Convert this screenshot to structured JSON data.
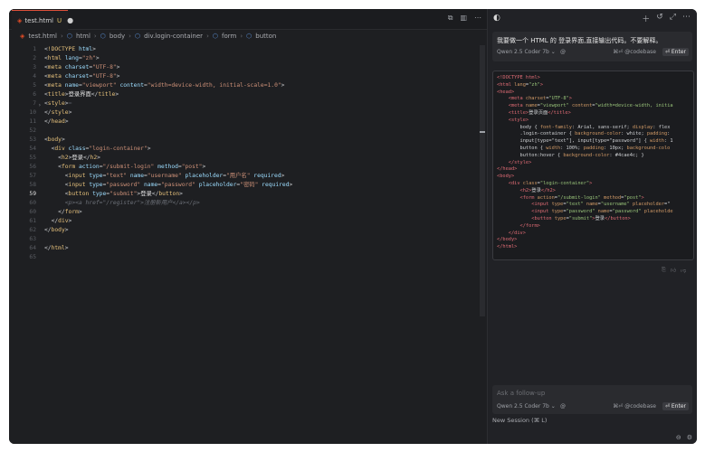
{
  "editor": {
    "tab": {
      "filename": "test.html",
      "badge": "U",
      "dot": "●"
    },
    "toolbar_icons": [
      "compare-icon",
      "split-icon",
      "more-icon"
    ],
    "breadcrumb": [
      "test.html",
      "html",
      "body",
      "div.login-container",
      "form",
      "button"
    ],
    "lines": [
      {
        "n": "1",
        "segs": [
          [
            "br",
            "<"
          ],
          [
            "tag",
            "!DOCTYPE"
          ],
          [
            "br",
            " "
          ],
          [
            "attr",
            "html"
          ],
          [
            "br",
            ">"
          ]
        ]
      },
      {
        "n": "2",
        "segs": [
          [
            "br",
            "<"
          ],
          [
            "tag",
            "html"
          ],
          [
            "br",
            " "
          ],
          [
            "attr",
            "lang"
          ],
          [
            "br",
            "="
          ],
          [
            "str",
            "\"zh\""
          ],
          [
            "br",
            ">"
          ]
        ]
      },
      {
        "n": "3",
        "segs": [
          [
            "br",
            "<"
          ],
          [
            "tag",
            "meta"
          ],
          [
            "br",
            " "
          ],
          [
            "attr",
            "charset"
          ],
          [
            "br",
            "="
          ],
          [
            "str",
            "\"UTF-8\""
          ],
          [
            "br",
            ">"
          ]
        ]
      },
      {
        "n": "4",
        "segs": [
          [
            "br",
            "<"
          ],
          [
            "tag",
            "meta"
          ],
          [
            "br",
            " "
          ],
          [
            "attr",
            "charset"
          ],
          [
            "br",
            "="
          ],
          [
            "str",
            "\"UTF-8\""
          ],
          [
            "br",
            ">"
          ]
        ]
      },
      {
        "n": "5",
        "segs": [
          [
            "br",
            "<"
          ],
          [
            "tag",
            "meta"
          ],
          [
            "br",
            " "
          ],
          [
            "attr",
            "name"
          ],
          [
            "br",
            "="
          ],
          [
            "str",
            "\"viewport\""
          ],
          [
            "br",
            " "
          ],
          [
            "attr",
            "content"
          ],
          [
            "br",
            "="
          ],
          [
            "str",
            "\"width=device-width, initial-scale=1.0\""
          ],
          [
            "br",
            ">"
          ]
        ]
      },
      {
        "n": "6",
        "segs": [
          [
            "br",
            "<"
          ],
          [
            "tag",
            "title"
          ],
          [
            "br",
            ">"
          ],
          [
            "text",
            "登录界面"
          ],
          [
            "br",
            "</"
          ],
          [
            "tag",
            "title"
          ],
          [
            "br",
            ">"
          ]
        ]
      },
      {
        "n": "7",
        "segs": [
          [
            "br",
            "<"
          ],
          [
            "tag",
            "style"
          ],
          [
            "br",
            ">"
          ],
          [
            "com",
            "⋯"
          ]
        ]
      },
      {
        "n": "10",
        "segs": [
          [
            "br",
            "</"
          ],
          [
            "tag",
            "style"
          ],
          [
            "br",
            ">"
          ]
        ]
      },
      {
        "n": "11",
        "segs": [
          [
            "br",
            "</"
          ],
          [
            "tag",
            "head"
          ],
          [
            "br",
            ">"
          ]
        ]
      },
      {
        "n": "52",
        "segs": []
      },
      {
        "n": "53",
        "segs": [
          [
            "br",
            "<"
          ],
          [
            "tag",
            "body"
          ],
          [
            "br",
            ">"
          ]
        ]
      },
      {
        "n": "54",
        "segs": [
          [
            "br",
            "  <"
          ],
          [
            "tag",
            "div"
          ],
          [
            "br",
            " "
          ],
          [
            "attr",
            "class"
          ],
          [
            "br",
            "="
          ],
          [
            "str",
            "\"login-container\""
          ],
          [
            "br",
            ">"
          ]
        ]
      },
      {
        "n": "55",
        "segs": [
          [
            "br",
            "    <"
          ],
          [
            "tag",
            "h2"
          ],
          [
            "br",
            ">"
          ],
          [
            "text",
            "登录"
          ],
          [
            "br",
            "</"
          ],
          [
            "tag",
            "h2"
          ],
          [
            "br",
            ">"
          ]
        ]
      },
      {
        "n": "56",
        "segs": [
          [
            "br",
            "    <"
          ],
          [
            "tag",
            "form"
          ],
          [
            "br",
            " "
          ],
          [
            "attr",
            "action"
          ],
          [
            "br",
            "="
          ],
          [
            "str",
            "\"/submit-login\""
          ],
          [
            "br",
            " "
          ],
          [
            "attr",
            "method"
          ],
          [
            "br",
            "="
          ],
          [
            "str",
            "\"post\""
          ],
          [
            "br",
            ">"
          ]
        ]
      },
      {
        "n": "57",
        "segs": [
          [
            "br",
            "      <"
          ],
          [
            "tag",
            "input"
          ],
          [
            "br",
            " "
          ],
          [
            "attr",
            "type"
          ],
          [
            "br",
            "="
          ],
          [
            "str",
            "\"text\""
          ],
          [
            "br",
            " "
          ],
          [
            "attr",
            "name"
          ],
          [
            "br",
            "="
          ],
          [
            "str",
            "\"username\""
          ],
          [
            "br",
            " "
          ],
          [
            "attr",
            "placeholder"
          ],
          [
            "br",
            "="
          ],
          [
            "str",
            "\"用户名\""
          ],
          [
            "br",
            " "
          ],
          [
            "attr",
            "required"
          ],
          [
            "br",
            ">"
          ]
        ]
      },
      {
        "n": "58",
        "segs": [
          [
            "br",
            "      <"
          ],
          [
            "tag",
            "input"
          ],
          [
            "br",
            " "
          ],
          [
            "attr",
            "type"
          ],
          [
            "br",
            "="
          ],
          [
            "str",
            "\"password\""
          ],
          [
            "br",
            " "
          ],
          [
            "attr",
            "name"
          ],
          [
            "br",
            "="
          ],
          [
            "str",
            "\"password\""
          ],
          [
            "br",
            " "
          ],
          [
            "attr",
            "placeholder"
          ],
          [
            "br",
            "="
          ],
          [
            "str",
            "\"密码\""
          ],
          [
            "br",
            " "
          ],
          [
            "attr",
            "required"
          ],
          [
            "br",
            ">"
          ]
        ]
      },
      {
        "n": "59",
        "cur": true,
        "segs": [
          [
            "br",
            "      <"
          ],
          [
            "tag",
            "button"
          ],
          [
            "br",
            " "
          ],
          [
            "attr",
            "type"
          ],
          [
            "br",
            "="
          ],
          [
            "str",
            "\"submit\""
          ],
          [
            "br",
            ">"
          ],
          [
            "text",
            "登录"
          ],
          [
            "br",
            "</"
          ],
          [
            "tag",
            "button"
          ],
          [
            "br",
            ">"
          ]
        ]
      },
      {
        "n": "60",
        "segs": [
          [
            "com",
            "      <p>"
          ],
          [
            "com",
            "<a href=\"/register\">"
          ],
          [
            "com",
            "注册新用户"
          ],
          [
            "com",
            "</a></p>"
          ]
        ]
      },
      {
        "n": "60",
        "segs": [
          [
            "br",
            "    </"
          ],
          [
            "tag",
            "form"
          ],
          [
            "br",
            ">"
          ]
        ]
      },
      {
        "n": "61",
        "segs": [
          [
            "br",
            "  </"
          ],
          [
            "tag",
            "div"
          ],
          [
            "br",
            ">"
          ]
        ]
      },
      {
        "n": "62",
        "segs": [
          [
            "br",
            "</"
          ],
          [
            "tag",
            "body"
          ],
          [
            "br",
            ">"
          ]
        ]
      },
      {
        "n": "63",
        "segs": []
      },
      {
        "n": "64",
        "segs": [
          [
            "br",
            "</"
          ],
          [
            "tag",
            "html"
          ],
          [
            "br",
            ">"
          ]
        ]
      },
      {
        "n": "65",
        "segs": []
      }
    ]
  },
  "chat": {
    "user_message": "我要做一个 HTML 的 登录界面,直接输出代码。不要解释。",
    "model": "Qwen 2.5 Coder 7b ⌄",
    "at": "@",
    "codebase": "⌘⏎ @codebase",
    "enter": "⏎ Enter",
    "code_lines": [
      [
        [
          "tag",
          "<!DOCTYPE html>"
        ]
      ],
      [
        [
          "tag",
          "<html"
        ],
        [
          "attr",
          " lang"
        ],
        [
          "c",
          "="
        ],
        [
          "str",
          "\"zh\""
        ],
        [
          "tag",
          ">"
        ]
      ],
      [
        [
          "tag",
          "<head>"
        ]
      ],
      [
        [
          "c",
          "    "
        ],
        [
          "tag",
          "<meta"
        ],
        [
          "attr",
          " charset"
        ],
        [
          "c",
          "="
        ],
        [
          "str",
          "\"UTF-8\""
        ],
        [
          "tag",
          ">"
        ]
      ],
      [
        [
          "c",
          "    "
        ],
        [
          "tag",
          "<meta"
        ],
        [
          "attr",
          " name"
        ],
        [
          "c",
          "="
        ],
        [
          "str",
          "\"viewport\""
        ],
        [
          "attr",
          " content"
        ],
        [
          "c",
          "="
        ],
        [
          "str",
          "\"width=device-width, initia"
        ]
      ],
      [
        [
          "c",
          "    "
        ],
        [
          "tag",
          "<title>"
        ],
        [
          "c",
          "登录页面"
        ],
        [
          "tag",
          "</title>"
        ]
      ],
      [
        [
          "c",
          "    "
        ],
        [
          "tag",
          "<style>"
        ]
      ],
      [
        [
          "c",
          "        body { "
        ],
        [
          "css",
          "font-family"
        ],
        [
          "c",
          ": Arial, sans-serif; "
        ],
        [
          "css",
          "display"
        ],
        [
          "c",
          ": flex"
        ]
      ],
      [
        [
          "c",
          "        .login-container { "
        ],
        [
          "css",
          "background-color"
        ],
        [
          "c",
          ": white; "
        ],
        [
          "css",
          "padding"
        ],
        [
          "c",
          ":"
        ]
      ],
      [
        [
          "c",
          "        input[type=\"text\"], input[type=\"password\"] { "
        ],
        [
          "css",
          "width"
        ],
        [
          "c",
          ": 1"
        ]
      ],
      [
        [
          "c",
          "        button { "
        ],
        [
          "css",
          "width"
        ],
        [
          "c",
          ": 100%; "
        ],
        [
          "css",
          "padding"
        ],
        [
          "c",
          ": 10px; "
        ],
        [
          "css",
          "background-colo"
        ]
      ],
      [
        [
          "c",
          "        button:hover { "
        ],
        [
          "css",
          "background-color"
        ],
        [
          "c",
          ": #4cae4c; }"
        ]
      ],
      [
        [
          "c",
          "    "
        ],
        [
          "tag",
          "</style>"
        ]
      ],
      [
        [
          "tag",
          "</head>"
        ]
      ],
      [
        [
          "tag",
          "<body>"
        ]
      ],
      [
        [
          "c",
          "    "
        ],
        [
          "tag",
          "<div"
        ],
        [
          "attr",
          " class"
        ],
        [
          "c",
          "="
        ],
        [
          "str",
          "\"login-container\""
        ],
        [
          "tag",
          ">"
        ]
      ],
      [
        [
          "c",
          "        "
        ],
        [
          "tag",
          "<h2>"
        ],
        [
          "c",
          "登录"
        ],
        [
          "tag",
          "</h2>"
        ]
      ],
      [
        [
          "c",
          "        "
        ],
        [
          "tag",
          "<form"
        ],
        [
          "attr",
          " action"
        ],
        [
          "c",
          "="
        ],
        [
          "str",
          "\"/submit-login\""
        ],
        [
          "attr",
          " method"
        ],
        [
          "c",
          "="
        ],
        [
          "str",
          "\"post\""
        ],
        [
          "tag",
          ">"
        ]
      ],
      [
        [
          "c",
          "            "
        ],
        [
          "tag",
          "<input"
        ],
        [
          "attr",
          " type"
        ],
        [
          "c",
          "="
        ],
        [
          "str",
          "\"text\""
        ],
        [
          "attr",
          " name"
        ],
        [
          "c",
          "="
        ],
        [
          "str",
          "\"username\""
        ],
        [
          "attr",
          " placeholder"
        ],
        [
          "c",
          "=\""
        ]
      ],
      [
        [
          "c",
          "            "
        ],
        [
          "tag",
          "<input"
        ],
        [
          "attr",
          " type"
        ],
        [
          "c",
          "="
        ],
        [
          "str",
          "\"password\""
        ],
        [
          "attr",
          " name"
        ],
        [
          "c",
          "="
        ],
        [
          "str",
          "\"password\""
        ],
        [
          "attr",
          " placeholde"
        ]
      ],
      [
        [
          "c",
          "            "
        ],
        [
          "tag",
          "<button"
        ],
        [
          "attr",
          " type"
        ],
        [
          "c",
          "="
        ],
        [
          "str",
          "\"submit\""
        ],
        [
          "tag",
          ">"
        ],
        [
          "c",
          "登录"
        ],
        [
          "tag",
          "</button>"
        ]
      ],
      [
        [
          "c",
          "        "
        ],
        [
          "tag",
          "</form>"
        ]
      ],
      [
        [
          "c",
          "    "
        ],
        [
          "tag",
          "</div>"
        ]
      ],
      [
        [
          "tag",
          "</body>"
        ]
      ],
      [
        [
          "tag",
          "</html>"
        ]
      ]
    ],
    "followup_placeholder": "Ask a follow-up",
    "new_session": "New Session (⌘ L)"
  }
}
